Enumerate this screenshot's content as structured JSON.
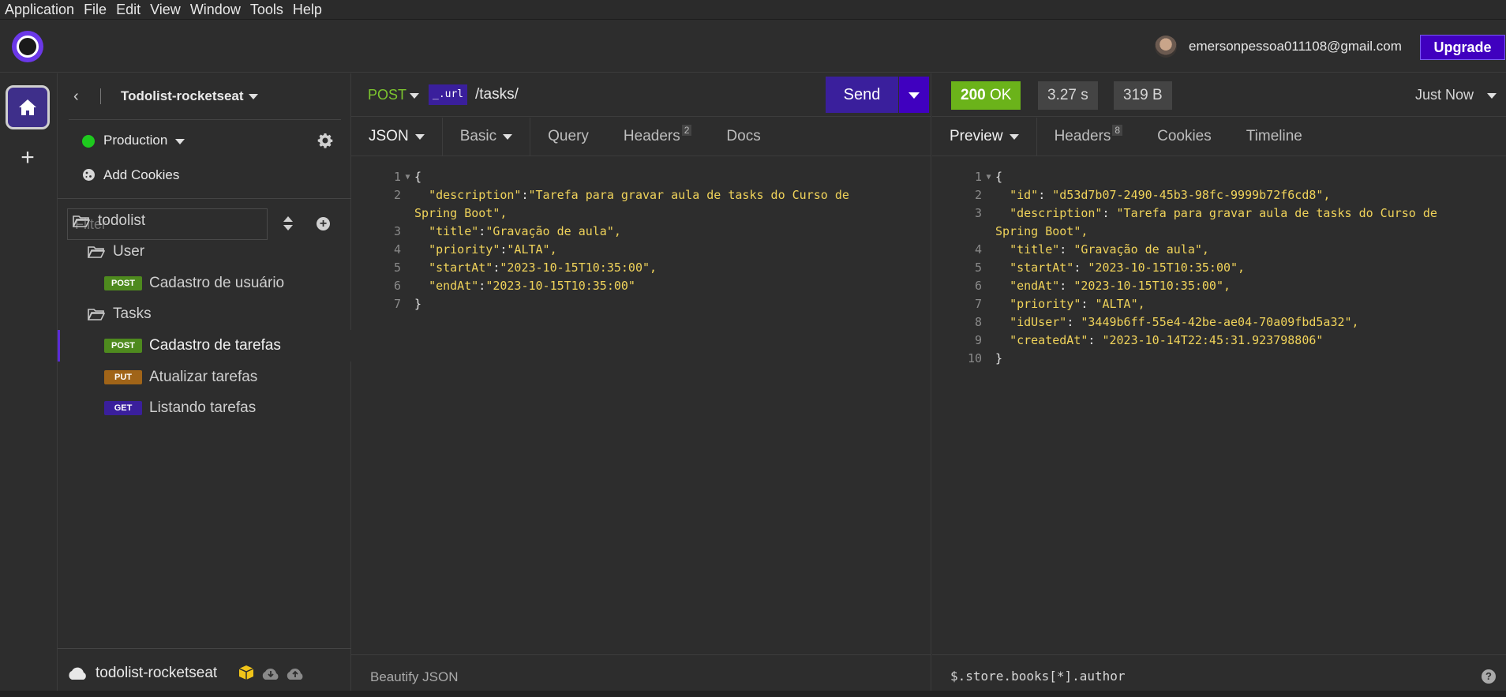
{
  "menu": [
    "Application",
    "File",
    "Edit",
    "View",
    "Window",
    "Tools",
    "Help"
  ],
  "header": {
    "email": "emersonpessoa011108@gmail.com",
    "upgrade_label": "Upgrade"
  },
  "sidebar": {
    "project_name": "Todolist-rocketseat",
    "environment": "Production",
    "add_cookies": "Add Cookies",
    "filter_placeholder": "Filter",
    "tree": {
      "root": "todolist",
      "folder_user": "User",
      "cadastro_usuario": {
        "method": "POST",
        "label": "Cadastro de usuário"
      },
      "folder_tasks": "Tasks",
      "cadastro_tarefas": {
        "method": "POST",
        "label": "Cadastro de tarefas"
      },
      "atualizar_tarefas": {
        "method": "PUT",
        "label": "Atualizar tarefas"
      },
      "listando_tarefas": {
        "method": "GET",
        "label": "Listando tarefas"
      }
    },
    "footer_name": "todolist-rocketseat"
  },
  "request": {
    "method": "POST",
    "url_var": "_.url",
    "url_path": "/tasks/",
    "send_label": "Send",
    "tabs": {
      "json": "JSON",
      "basic": "Basic",
      "query": "Query",
      "headers": "Headers",
      "headers_count": "2",
      "docs": "Docs"
    },
    "body_lines": [
      {
        "n": "1",
        "text": "{"
      },
      {
        "n": "2",
        "key": "\"description\"",
        "val": "\"Tarefa para gravar aula de tasks do Curso de"
      },
      {
        "n": "",
        "cont": "Spring Boot\","
      },
      {
        "n": "3",
        "key": "\"title\"",
        "val": "\"Gravação de aula\","
      },
      {
        "n": "4",
        "key": "\"priority\"",
        "val": "\"ALTA\","
      },
      {
        "n": "5",
        "key": "\"startAt\"",
        "val": "\"2023-10-15T10:35:00\","
      },
      {
        "n": "6",
        "key": "\"endAt\"",
        "val": "\"2023-10-15T10:35:00\""
      },
      {
        "n": "7",
        "text": "}"
      }
    ],
    "footer": "Beautify JSON"
  },
  "response": {
    "status_code": "200",
    "status_text": "OK",
    "time": "3.27 s",
    "size": "319 B",
    "when": "Just Now",
    "tabs": {
      "preview": "Preview",
      "headers": "Headers",
      "headers_count": "8",
      "cookies": "Cookies",
      "timeline": "Timeline"
    },
    "body_lines": [
      {
        "n": "1",
        "text": "{"
      },
      {
        "n": "2",
        "key": "\"id\"",
        "val": "\"d53d7b07-2490-45b3-98fc-9999b72f6cd8\","
      },
      {
        "n": "3",
        "key": "\"description\"",
        "val": "\"Tarefa para gravar aula de tasks do Curso de"
      },
      {
        "n": "",
        "cont": "Spring Boot\","
      },
      {
        "n": "4",
        "key": "\"title\"",
        "val": "\"Gravação de aula\","
      },
      {
        "n": "5",
        "key": "\"startAt\"",
        "val": "\"2023-10-15T10:35:00\","
      },
      {
        "n": "6",
        "key": "\"endAt\"",
        "val": "\"2023-10-15T10:35:00\","
      },
      {
        "n": "7",
        "key": "\"priority\"",
        "val": "\"ALTA\","
      },
      {
        "n": "8",
        "key": "\"idUser\"",
        "val": "\"3449b6ff-55e4-42be-ae04-70a09fbd5a32\","
      },
      {
        "n": "9",
        "key": "\"createdAt\"",
        "val": "\"2023-10-14T22:45:31.923798806\""
      },
      {
        "n": "10",
        "text": "}"
      }
    ],
    "filter": "$.store.books[*].author"
  },
  "colors": {
    "accent": "#4000bf",
    "post": "#4e8a1e",
    "put": "#a06418",
    "get": "#3a1f9c",
    "ok": "#6bb31a",
    "json_string": "#f0d35a"
  }
}
